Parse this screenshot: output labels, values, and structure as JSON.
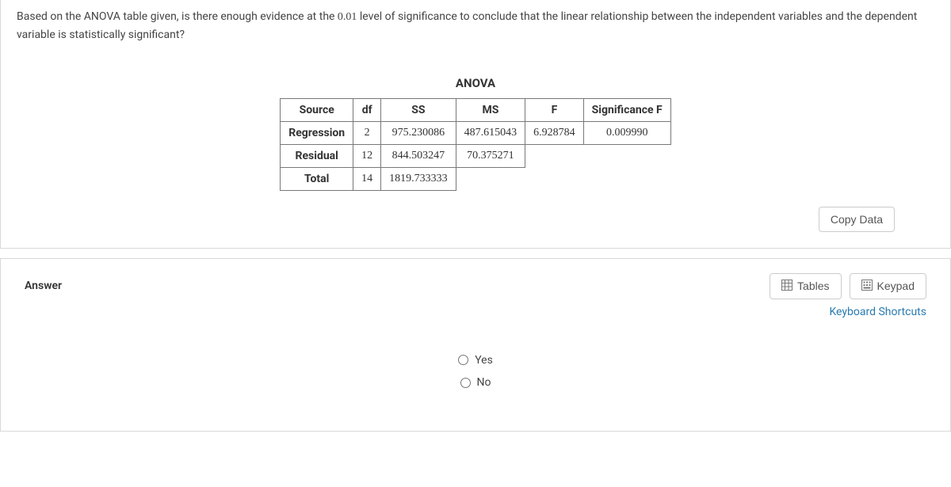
{
  "question": {
    "text_prefix": "Based on the ANOVA table given, is there enough evidence at the ",
    "sig_level": "0.01",
    "text_suffix": " level of significance to conclude that the linear relationship between the independent variables and the dependent variable is statistically significant?"
  },
  "anova": {
    "title": "ANOVA",
    "headers": [
      "Source",
      "df",
      "SS",
      "MS",
      "F",
      "Significance F"
    ],
    "rows": [
      {
        "source": "Regression",
        "df": "2",
        "ss": "975.230086",
        "ms": "487.615043",
        "f": "6.928784",
        "sigf": "0.009990"
      },
      {
        "source": "Residual",
        "df": "12",
        "ss": "844.503247",
        "ms": "70.375271",
        "f": "",
        "sigf": ""
      },
      {
        "source": "Total",
        "df": "14",
        "ss": "1819.733333",
        "ms": "",
        "f": "",
        "sigf": ""
      }
    ]
  },
  "buttons": {
    "copy_data": "Copy Data",
    "tables": "Tables",
    "keypad": "Keypad"
  },
  "answer": {
    "label": "Answer",
    "shortcuts": "Keyboard Shortcuts",
    "options": {
      "yes": "Yes",
      "no": "No"
    }
  },
  "chart_data": {
    "type": "table",
    "title": "ANOVA",
    "columns": [
      "Source",
      "df",
      "SS",
      "MS",
      "F",
      "Significance F"
    ],
    "rows": [
      [
        "Regression",
        2,
        975.230086,
        487.615043,
        6.928784,
        0.00999
      ],
      [
        "Residual",
        12,
        844.503247,
        70.375271,
        null,
        null
      ],
      [
        "Total",
        14,
        1819.733333,
        null,
        null,
        null
      ]
    ]
  }
}
